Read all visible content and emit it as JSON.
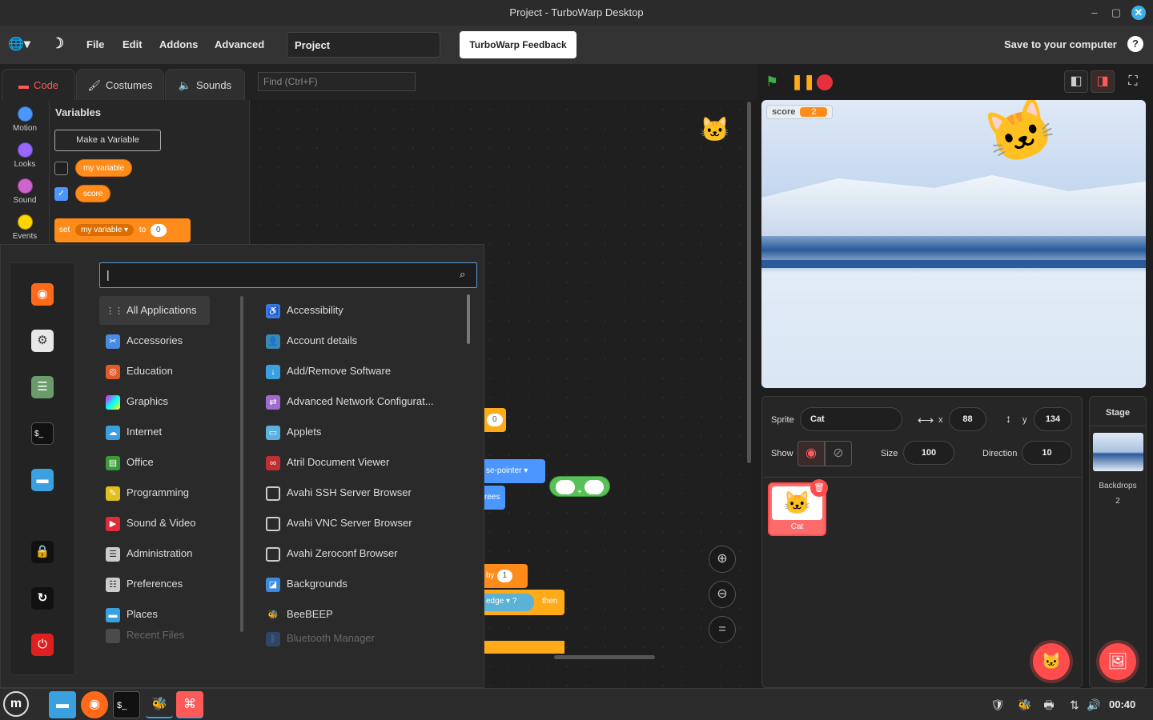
{
  "window": {
    "title": "Project - TurboWarp Desktop"
  },
  "menubar": {
    "items": [
      "File",
      "Edit",
      "Addons",
      "Advanced"
    ],
    "project_name": "Project",
    "feedback": "TurboWarp Feedback",
    "save": "Save to your computer",
    "help": "?"
  },
  "tabs": {
    "code": "Code",
    "costumes": "Costumes",
    "sounds": "Sounds",
    "find_placeholder": "Find (Ctrl+F)"
  },
  "categories": [
    {
      "label": "Motion",
      "color": "#4c97ff"
    },
    {
      "label": "Looks",
      "color": "#9966ff"
    },
    {
      "label": "Sound",
      "color": "#cf63cf"
    },
    {
      "label": "Events",
      "color": "#ffd500"
    }
  ],
  "palette": {
    "heading": "Variables",
    "make_variable": "Make a Variable",
    "variables": [
      {
        "name": "my variable",
        "checked": false
      },
      {
        "name": "score",
        "checked": true
      }
    ],
    "set_block": {
      "set": "set",
      "var": "my variable",
      "to": "to",
      "value": "0"
    }
  },
  "workspace": {
    "frag_value": "0",
    "frag_pointer": "se-pointer",
    "frag_rees": "rees",
    "frag_plus": "+",
    "frag_by": "by",
    "frag_by_value": "1",
    "frag_edge": "edge",
    "frag_q": "?",
    "frag_then": "then"
  },
  "stage": {
    "monitor_label": "score",
    "monitor_value": "2"
  },
  "sprite": {
    "sprite_label": "Sprite",
    "name": "Cat",
    "x_label": "x",
    "x": "88",
    "y_label": "y",
    "y": "134",
    "show_label": "Show",
    "size_label": "Size",
    "size": "100",
    "direction_label": "Direction",
    "direction": "10",
    "thumb_label": "Cat"
  },
  "stage_panel": {
    "title": "Stage",
    "backdrops_label": "Backdrops",
    "backdrops_count": "2"
  },
  "startmenu": {
    "search_value": "|",
    "categories": [
      "All Applications",
      "Accessories",
      "Education",
      "Graphics",
      "Internet",
      "Office",
      "Programming",
      "Sound & Video",
      "Administration",
      "Preferences",
      "Places",
      "Recent Files"
    ],
    "apps": [
      "Accessibility",
      "Account details",
      "Add/Remove Software",
      "Advanced Network Configurat...",
      "Applets",
      "Atril Document Viewer",
      "Avahi SSH Server Browser",
      "Avahi VNC Server Browser",
      "Avahi Zeroconf Browser",
      "Backgrounds",
      "BeeBEEP",
      "Bluetooth Manager"
    ]
  },
  "taskbar": {
    "clock": "00:40"
  }
}
